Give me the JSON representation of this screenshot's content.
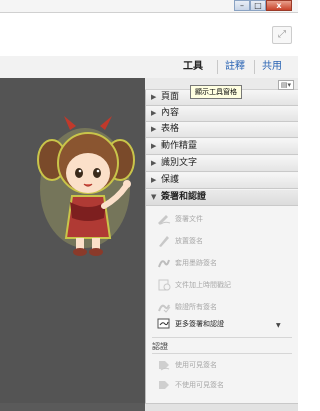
{
  "window": {
    "minimize": "–",
    "maximize": "□",
    "close": "x"
  },
  "toolbar": {
    "expand_icon": "⤢"
  },
  "tabs": {
    "tools": "工具",
    "comment": "註釋",
    "share": "共用"
  },
  "task_pane": {
    "tooltip": "顯示工具窗格",
    "options_icon": "▤▾",
    "panels": [
      {
        "label": "頁面",
        "expanded": false
      },
      {
        "label": "內容",
        "expanded": false
      },
      {
        "label": "表格",
        "expanded": false
      },
      {
        "label": "動作精靈",
        "expanded": false
      },
      {
        "label": "識別文字",
        "expanded": false
      },
      {
        "label": "保護",
        "expanded": false
      },
      {
        "label": "簽署和認證",
        "expanded": true
      }
    ],
    "sign_items": [
      {
        "label": "簽署文件",
        "icon": "signature-pen-icon",
        "enabled": false
      },
      {
        "label": "放置簽名",
        "icon": "pen-icon",
        "enabled": false
      },
      {
        "label": "套用墨跡簽名",
        "icon": "ink-signature-icon",
        "enabled": false
      },
      {
        "label": "文件加上時間戳記",
        "icon": "timestamp-icon",
        "enabled": false
      },
      {
        "label": "驗證所有簽名",
        "icon": "validate-icon",
        "enabled": false
      },
      {
        "label": "更多簽署和認證",
        "icon": "more-sign-icon",
        "enabled": true
      }
    ],
    "certify_section": {
      "label": "認證",
      "items": [
        {
          "label": "使用可見簽名",
          "icon": "certify-visible-icon",
          "enabled": false
        },
        {
          "label": "不使用可見簽名",
          "icon": "certify-invisible-icon",
          "enabled": false
        }
      ]
    }
  },
  "colors": {
    "doc_background": "#545454",
    "link_blue": "#2a64b4",
    "tooltip_bg": "#ffffe1"
  }
}
